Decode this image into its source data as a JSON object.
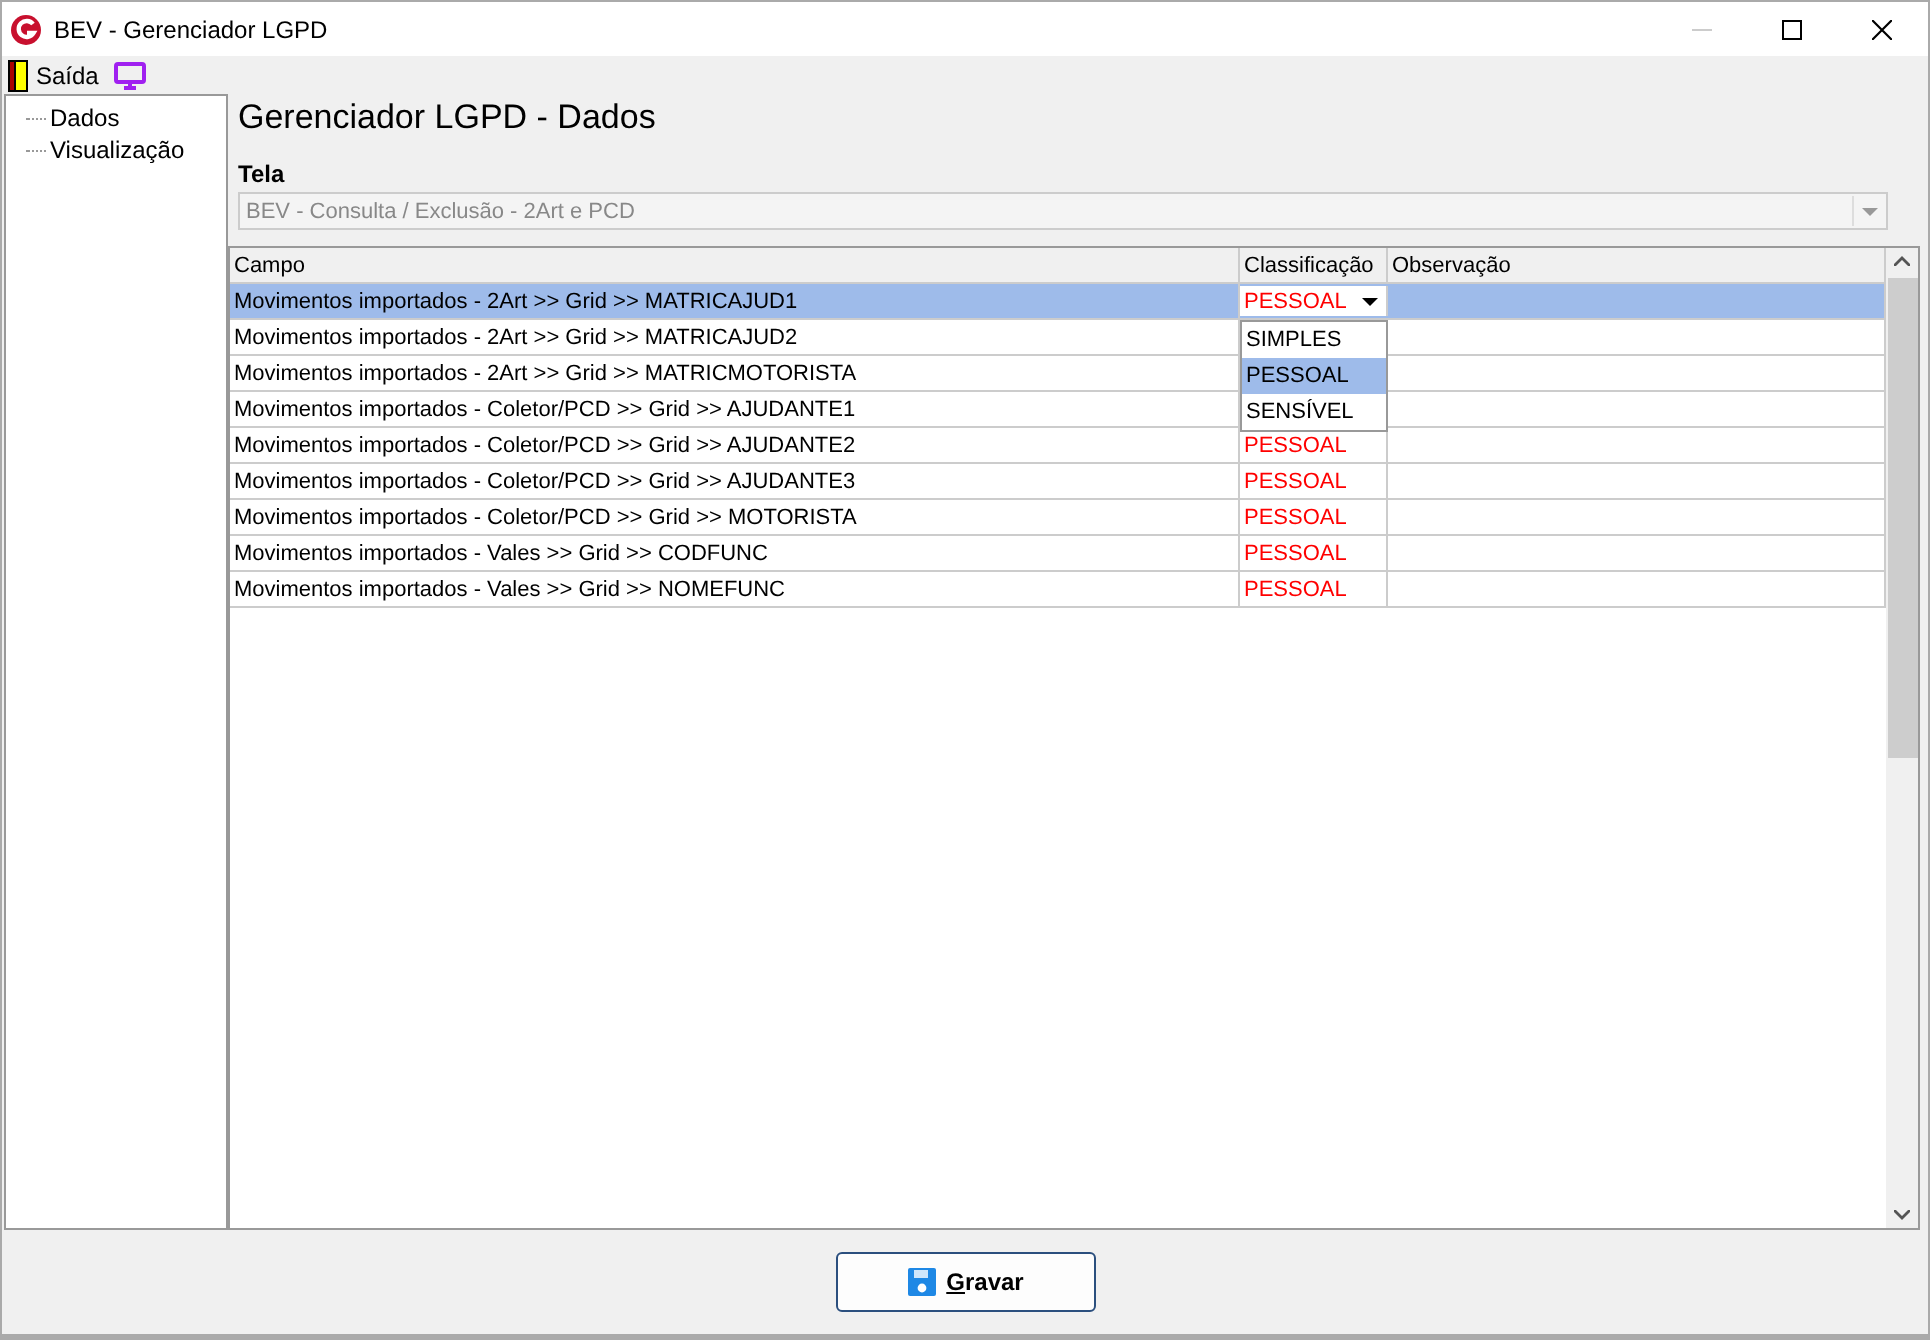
{
  "window": {
    "title": "BEV - Gerenciador LGPD"
  },
  "toolbar": {
    "exit_label": "Saída"
  },
  "sidebar": {
    "items": [
      {
        "label": "Dados"
      },
      {
        "label": "Visualização"
      }
    ]
  },
  "page_title": "Gerenciador LGPD - Dados",
  "tela": {
    "label": "Tela",
    "value": "BEV - Consulta / Exclusão - 2Art e PCD"
  },
  "table": {
    "columns": [
      "Campo",
      "Classificação",
      "Observação"
    ],
    "rows": [
      {
        "campo": "Movimentos importados - 2Art >> Grid >> MATRICAJUD1",
        "classificacao": "PESSOAL",
        "selected": true,
        "editing": true
      },
      {
        "campo": "Movimentos importados - 2Art >> Grid >> MATRICAJUD2",
        "selected": false,
        "editing": false
      },
      {
        "campo": "Movimentos importados - 2Art >> Grid >> MATRICMOTORISTA",
        "selected": false,
        "editing": false
      },
      {
        "campo": "Movimentos importados - Coletor/PCD >> Grid >> AJUDANTE1",
        "selected": false,
        "editing": false
      },
      {
        "campo": "Movimentos importados - Coletor/PCD >> Grid >> AJUDANTE2",
        "classificacao": "PESSOAL",
        "selected": false,
        "editing": false
      },
      {
        "campo": "Movimentos importados - Coletor/PCD >> Grid >> AJUDANTE3",
        "classificacao": "PESSOAL",
        "selected": false,
        "editing": false
      },
      {
        "campo": "Movimentos importados - Coletor/PCD >> Grid >> MOTORISTA",
        "classificacao": "PESSOAL",
        "selected": false,
        "editing": false
      },
      {
        "campo": "Movimentos importados - Vales >> Grid >> CODFUNC",
        "classificacao": "PESSOAL",
        "selected": false,
        "editing": false
      },
      {
        "campo": "Movimentos importados - Vales >> Grid >> NOMEFUNC",
        "classificacao": "PESSOAL",
        "selected": false,
        "editing": false
      }
    ],
    "dropdown": {
      "options": [
        {
          "label": "SIMPLES",
          "selected": false
        },
        {
          "label": "PESSOAL",
          "selected": true
        },
        {
          "label": "SENSÍVEL",
          "selected": false
        }
      ]
    }
  },
  "buttons": [
    {
      "label": "Gravar"
    }
  ]
}
